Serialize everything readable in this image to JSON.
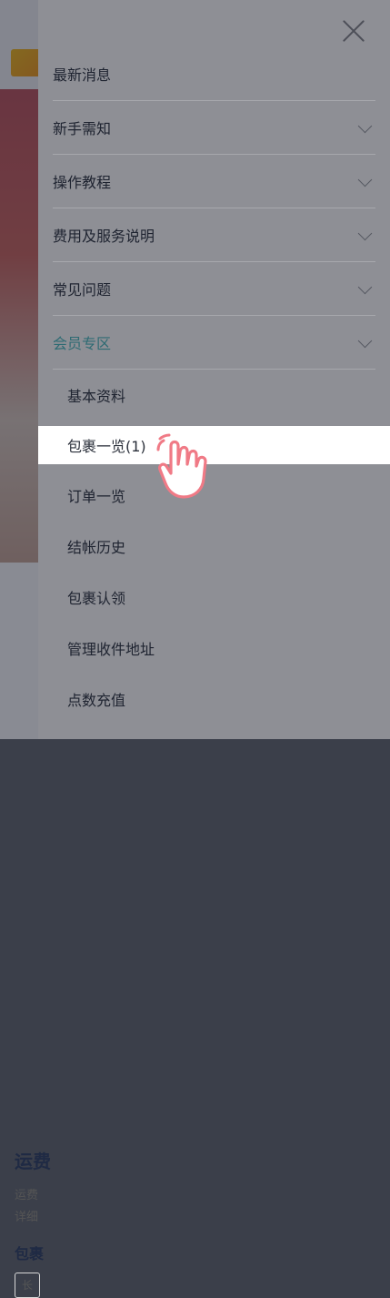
{
  "background": {
    "title": "运费",
    "desc_line1": "运费",
    "desc_line2": "详细",
    "subtitle": "包裹",
    "chip": "长"
  },
  "menu": {
    "items": [
      {
        "label": "最新消息",
        "has_chevron": false
      },
      {
        "label": "新手需知",
        "has_chevron": true
      },
      {
        "label": "操作教程",
        "has_chevron": true
      },
      {
        "label": "费用及服务说明",
        "has_chevron": true
      },
      {
        "label": "常见问题",
        "has_chevron": true
      },
      {
        "label": "会员专区",
        "has_chevron": true,
        "active": true
      }
    ],
    "member_submenu": [
      {
        "label": "基本资料"
      },
      {
        "label": "包裹一览(1)",
        "selected": true
      },
      {
        "label": "订单一览"
      },
      {
        "label": "结帐历史"
      },
      {
        "label": "包裹认领"
      },
      {
        "label": "管理收件地址"
      },
      {
        "label": "点数充值"
      }
    ]
  },
  "icons": {
    "close": "close-icon",
    "chevron": "chevron-down-icon",
    "pointer": "hand-pointer-icon"
  },
  "colors": {
    "drawer_bg": "#8e8f95",
    "active_text": "#2e6b73",
    "selected_bg": "#ffffff",
    "hand_pink": "#f07a86"
  }
}
